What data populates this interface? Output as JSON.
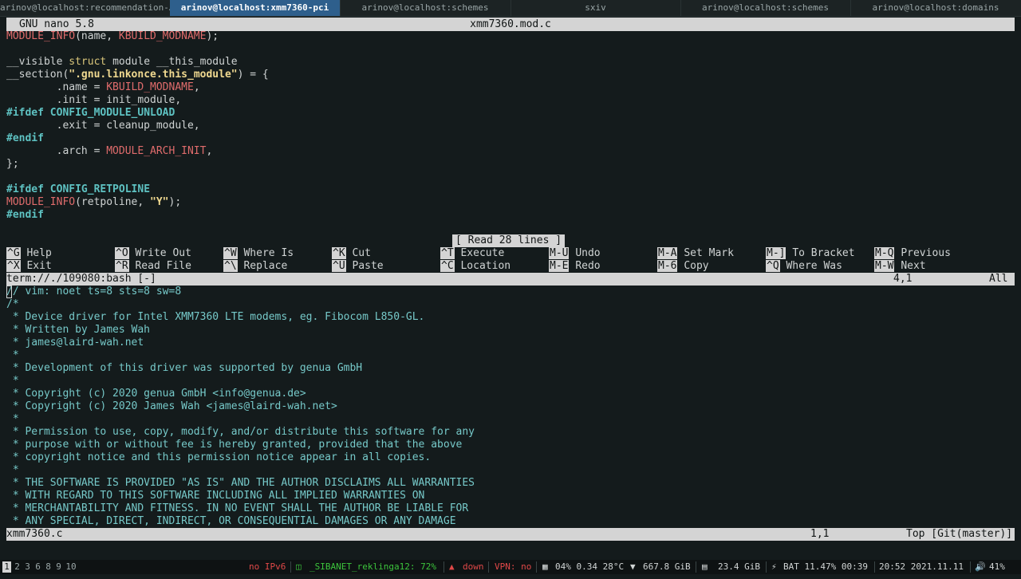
{
  "tabs": [
    {
      "label": "arinov@localhost:recommendation-…",
      "active": false
    },
    {
      "label": "arinov@localhost:xmm7360-pci",
      "active": true
    },
    {
      "label": "arinov@localhost:schemes",
      "active": false
    },
    {
      "label": "sxiv",
      "active": false
    },
    {
      "label": "arinov@localhost:schemes",
      "active": false
    },
    {
      "label": "arinov@localhost:domains",
      "active": false
    }
  ],
  "nano": {
    "version": "GNU nano 5.8",
    "filename": "xmm7360.mod.c",
    "status": "[ Read 28 lines ]"
  },
  "code": {
    "l1_mac": "MODULE_INFO",
    "l1_rest": "(name, ",
    "l1_mac2": "KBUILD_MODNAME",
    "l1_end": ");",
    "l3_a": "__visible ",
    "l3_kw": "struct",
    "l3_b": " module __this_module",
    "l4_a": "__section(",
    "l4_str": "\".gnu.linkonce.this_module\"",
    "l4_b": ") = {",
    "l5_a": "        .name = ",
    "l5_mac": "KBUILD_MODNAME",
    "l5_b": ",",
    "l6": "        .init = init_module,",
    "l7_pp": "#ifdef",
    "l7_b": " CONFIG_MODULE_UNLOAD",
    "l8": "        .exit = cleanup_module,",
    "l9_pp": "#endif",
    "l10_a": "        .arch = ",
    "l10_mac": "MODULE_ARCH_INIT",
    "l10_b": ",",
    "l11": "};",
    "l13_pp": "#ifdef",
    "l13_b": " CONFIG_RETPOLINE",
    "l14_mac": "MODULE_INFO",
    "l14_a": "(retpoline, ",
    "l14_str": "\"Y\"",
    "l14_b": ");",
    "l15_pp": "#endif"
  },
  "shortcuts_row1": [
    {
      "key": "^G",
      "label": "Help"
    },
    {
      "key": "^O",
      "label": "Write Out"
    },
    {
      "key": "^W",
      "label": "Where Is"
    },
    {
      "key": "^K",
      "label": "Cut"
    },
    {
      "key": "^T",
      "label": "Execute"
    },
    {
      "key": "M-U",
      "label": "Undo"
    },
    {
      "key": "M-A",
      "label": "Set Mark"
    },
    {
      "key": "M-]",
      "label": "To Bracket"
    },
    {
      "key": "M-Q",
      "label": "Previous"
    }
  ],
  "shortcuts_row2": [
    {
      "key": "^X",
      "label": "Exit"
    },
    {
      "key": "^R",
      "label": "Read File"
    },
    {
      "key": "^\\",
      "label": "Replace"
    },
    {
      "key": "^U",
      "label": "Paste"
    },
    {
      "key": "^C",
      "label": "Location"
    },
    {
      "key": "M-E",
      "label": "Redo"
    },
    {
      "key": "M-6",
      "label": "Copy"
    },
    {
      "key": "^Q",
      "label": "Where Was"
    },
    {
      "key": "M-W",
      "label": "Next"
    }
  ],
  "term_bar": {
    "name": "term://./109080:bash [-]",
    "pos": "4,1",
    "scroll": "All"
  },
  "source_lines": [
    "// vim: noet ts=8 sts=8 sw=8",
    "/*",
    " * Device driver for Intel XMM7360 LTE modems, eg. Fibocom L850-GL.",
    " * Written by James Wah",
    " * james@laird-wah.net",
    " *",
    " * Development of this driver was supported by genua GmbH",
    " *",
    " * Copyright (c) 2020 genua GmbH <info@genua.de>",
    " * Copyright (c) 2020 James Wah <james@laird-wah.net>",
    " *",
    " * Permission to use, copy, modify, and/or distribute this software for any",
    " * purpose with or without fee is hereby granted, provided that the above",
    " * copyright notice and this permission notice appear in all copies.",
    " *",
    " * THE SOFTWARE IS PROVIDED \"AS IS\" AND THE AUTHOR DISCLAIMS ALL WARRANTIES",
    " * WITH REGARD TO THIS SOFTWARE INCLUDING ALL IMPLIED WARRANTIES ON",
    " * MERCHANTABILITY AND FITNESS. IN NO EVENT SHALL THE AUTHOR BE LIABLE FOR",
    " * ANY SPECIAL, DIRECT, INDIRECT, OR CONSEQUENTIAL DAMAGES OR ANY DAMAGE"
  ],
  "file_bar": {
    "name": "xmm7360.c",
    "pos": "1,1",
    "scroll": "Top [Git(master)]"
  },
  "workspaces": [
    "1",
    "2",
    "3",
    "6",
    "8",
    "9",
    "10"
  ],
  "system": {
    "ipv6": "no IPv6",
    "wifi": "_SIBANET_reklinga12: 72%",
    "eth": "down",
    "vpn": "VPN: no",
    "cpu": "04% 0.34 28°C",
    "disk": "667.8 GiB",
    "mem": "23.4 GiB",
    "bat": "BAT 11.47% 00:39",
    "datetime": "20:52 2021.11.11",
    "volume": "41%"
  },
  "colors": {
    "active_tab": "#2e5f8c",
    "ipv6": "#e04848",
    "wifi": "#3cc43c",
    "eth": "#e04848",
    "vpn": "#e04848"
  }
}
